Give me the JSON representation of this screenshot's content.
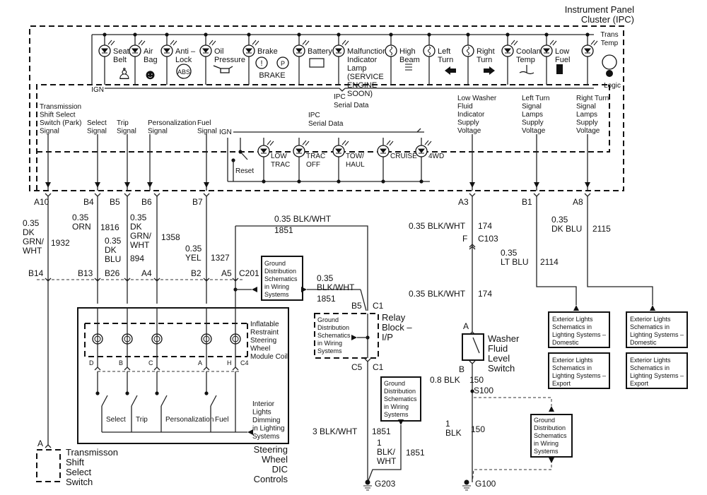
{
  "ipc": {
    "title_line1": "Instrument Panel",
    "title_line2": "Cluster (IPC)",
    "ign": "IGN",
    "logic": "Logic",
    "serial_data_1": [
      "IPC",
      "Serial Data"
    ],
    "serial_data_2": [
      "IPC",
      "Serial Data"
    ],
    "ign2": "IGN",
    "reset": "Reset",
    "indicators": [
      {
        "lines": [
          "Seat",
          "Belt"
        ],
        "icon": "seat-belt-icon"
      },
      {
        "lines": [
          "Air",
          "Bag"
        ],
        "icon": "air-bag-icon"
      },
      {
        "lines": [
          "Anti –",
          "Lock"
        ],
        "icon": "abs-icon",
        "badge": "ABS"
      },
      {
        "lines": [
          "Oil",
          "Pressure"
        ],
        "icon": "oil-can-icon"
      },
      {
        "lines": [
          "Brake"
        ],
        "icon": "brake-icon",
        "sub": "BRAKE"
      },
      {
        "lines": [
          "Battery"
        ],
        "icon": "battery-icon"
      },
      {
        "lines": [
          "Malfunction",
          "Indicator",
          "Lamp",
          "(SERVICE",
          "ENGINE",
          "SOON)"
        ],
        "icon": "led-icon"
      },
      {
        "lines": [
          "High",
          "Beam"
        ],
        "icon": "high-beam-icon"
      },
      {
        "lines": [
          "Left",
          "Turn"
        ],
        "icon": "left-arrow-icon"
      },
      {
        "lines": [
          "Right",
          "Turn"
        ],
        "icon": "right-arrow-icon"
      },
      {
        "lines": [
          "Coolant",
          "Temp"
        ],
        "icon": "coolant-temp-icon"
      },
      {
        "lines": [
          "Low",
          "Fuel"
        ],
        "icon": "fuel-pump-icon"
      },
      {
        "lines": [
          "Trans",
          "Temp"
        ],
        "icon": "trans-temp-icon"
      }
    ],
    "lower_lamps": [
      {
        "lines": [
          "LOW",
          "TRAC"
        ]
      },
      {
        "lines": [
          "TRAC",
          "OFF"
        ]
      },
      {
        "lines": [
          "TOW/",
          "HAUL"
        ]
      },
      {
        "lines": [
          "CRUISE"
        ]
      },
      {
        "lines": [
          "4WD"
        ]
      }
    ],
    "signals": [
      {
        "lines": [
          "Transmission",
          "Shift Select",
          "Switch (Park)",
          "Signal"
        ]
      },
      {
        "lines": [
          "Select",
          "Signal"
        ]
      },
      {
        "lines": [
          "Trip",
          "Signal"
        ]
      },
      {
        "lines": [
          "Personalization",
          "Signal"
        ]
      },
      {
        "lines": [
          "Fuel",
          "Signal"
        ]
      },
      {
        "lines": [
          "Low Washer",
          "Fluid",
          "Indicator",
          "Supply",
          "Voltage"
        ]
      },
      {
        "lines": [
          "Left Turn",
          "Signal",
          "Lamps",
          "Supply",
          "Voltage"
        ]
      },
      {
        "lines": [
          "Right Turn",
          "Signal",
          "Lamps",
          "Supply",
          "Voltage"
        ]
      }
    ]
  },
  "pins": {
    "top": [
      "A10",
      "B4",
      "B5",
      "B6",
      "B7",
      "A3",
      "B1",
      "A8"
    ],
    "c201": [
      "B14",
      "B13",
      "B26",
      "A4",
      "B2",
      "A5"
    ],
    "c201_label": "C201"
  },
  "wires": [
    {
      "lines": [
        "0.35",
        "DK",
        "GRN/",
        "WHT"
      ],
      "circuit": "1932"
    },
    {
      "lines": [
        "0.35",
        "ORN"
      ],
      "circuit": "1816"
    },
    {
      "lines": [
        "0.35",
        "DK",
        "BLU"
      ],
      "circuit": "894"
    },
    {
      "lines": [
        "0.35",
        "DK",
        "GRN/",
        "WHT"
      ],
      "circuit": "1358"
    },
    {
      "lines": [
        "0.35",
        "YEL"
      ],
      "circuit": "1327"
    },
    {
      "lines": [
        "0.35 BLK/WHT"
      ],
      "circuit": "1851"
    },
    {
      "lines": [
        "0.35",
        "BLK/WHT"
      ],
      "circuit": "1851"
    },
    {
      "lines": [
        "0.35 BLK/WHT"
      ],
      "circuit": "174"
    },
    {
      "lines": [
        "0.35 BLK/WHT"
      ],
      "circuit": "174"
    },
    {
      "lines": [
        "0.35",
        "LT BLU"
      ],
      "circuit": "2114"
    },
    {
      "lines": [
        "0.35",
        "DK BLU"
      ],
      "circuit": "2115"
    },
    {
      "lines": [
        "3 BLK/WHT"
      ],
      "circuit": "1851"
    },
    {
      "lines": [
        "1",
        "BLK/",
        "WHT"
      ],
      "circuit": "1851"
    },
    {
      "lines": [
        "0.8 BLK"
      ],
      "circuit": "150"
    },
    {
      "lines": [
        "1",
        "BLK"
      ],
      "circuit": "150"
    }
  ],
  "connectors": {
    "c103_pin": "F",
    "c103": "C103",
    "relay_b5": "B5",
    "relay_c1_top": "C1",
    "relay_c5": "C5",
    "relay_c1_bot": "C1",
    "washer_a": "A",
    "washer_b": "B",
    "s100": "S100",
    "g203": "G203",
    "g100": "G100",
    "trans_a": "A",
    "coil_pins": [
      "D",
      "B",
      "C",
      "A",
      "H"
    ],
    "coil_conn": "C4"
  },
  "components": {
    "relay_block": [
      "Relay",
      "Block –",
      "I/P"
    ],
    "washer_switch": [
      "Washer",
      "Fluid",
      "Level",
      "Switch"
    ],
    "trans_switch": [
      "Transmisson",
      "Shift",
      "Select",
      "Switch"
    ],
    "steering": [
      "Steering",
      "Wheel",
      "DIC",
      "Controls"
    ],
    "coil": [
      "Inflatable",
      "Restraint",
      "Steering",
      "Wheel",
      "Module Coil"
    ],
    "dimming": [
      "Interior",
      "Lights",
      "Dimming",
      "in Lighting",
      "Systems"
    ],
    "switches": [
      "Select",
      "Trip",
      "Personalization",
      "Fuel"
    ]
  },
  "references": {
    "ground": [
      "Ground",
      "Distribution",
      "Schematics",
      "in Wiring",
      "Systems"
    ],
    "ext_domestic": [
      "Exterior Lights",
      "Schematics in",
      "Lighting Systems –",
      "Domestic"
    ],
    "ext_export": [
      "Exterior Lights",
      "Schematics in",
      "Lighting Systems –",
      "Export"
    ]
  }
}
